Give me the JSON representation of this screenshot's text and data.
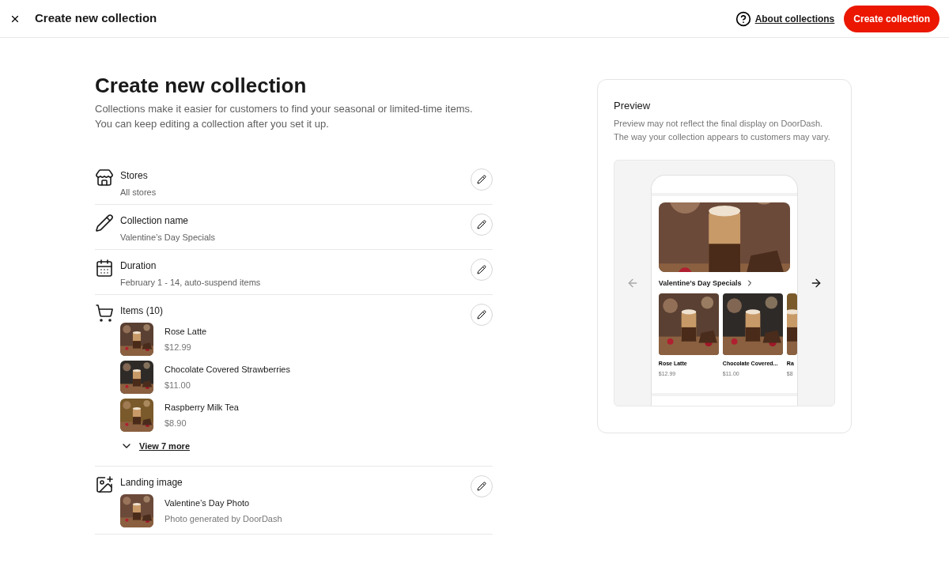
{
  "header": {
    "title": "Create new collection",
    "help_link": "About collections",
    "primary_button": "Create collection"
  },
  "page": {
    "title": "Create new collection",
    "description": "Collections make it easier for customers to find your seasonal or limited-time items. You can keep editing a collection after you set it up."
  },
  "sections": [
    {
      "kind": "stores",
      "label": "Stores",
      "value": "All stores"
    },
    {
      "kind": "name",
      "label": "Collection name",
      "value": "Valentine’s Day Specials"
    },
    {
      "kind": "duration",
      "label": "Duration",
      "value": "February 1 - 14, auto-suspend items"
    },
    {
      "kind": "items",
      "label": "Items (10)",
      "items": [
        {
          "name": "Rose Latte",
          "price": "$12.99",
          "kind": "picture"
        },
        {
          "name": "Chocolate Covered Strawberries",
          "price": "$11.00",
          "kind": "picture"
        },
        {
          "name": "Raspberry Milk Tea",
          "price": "$8.90",
          "kind": "picture"
        }
      ],
      "more_link": "View 7 more"
    },
    {
      "kind": "landing",
      "label": "Landing image",
      "items": [
        {
          "name": "Valentine’s Day Photo",
          "price": "Photo generated by DoorDash",
          "kind": "picture"
        }
      ]
    }
  ],
  "preview": {
    "title": "Preview",
    "note": "Preview may not reflect the final display on DoorDash. The way your collection appears to customers may vary.",
    "carousel": {
      "prev_disabled": true,
      "next_disabled": false
    },
    "phone": {
      "collection_title": "Valentine’s Day Specials",
      "cards": [
        {
          "name": "Rose Latte",
          "price": "$12.99"
        },
        {
          "name": "Chocolate Covered...",
          "price": "$11.00"
        },
        {
          "name": "Ra",
          "price": "$8"
        }
      ]
    }
  }
}
